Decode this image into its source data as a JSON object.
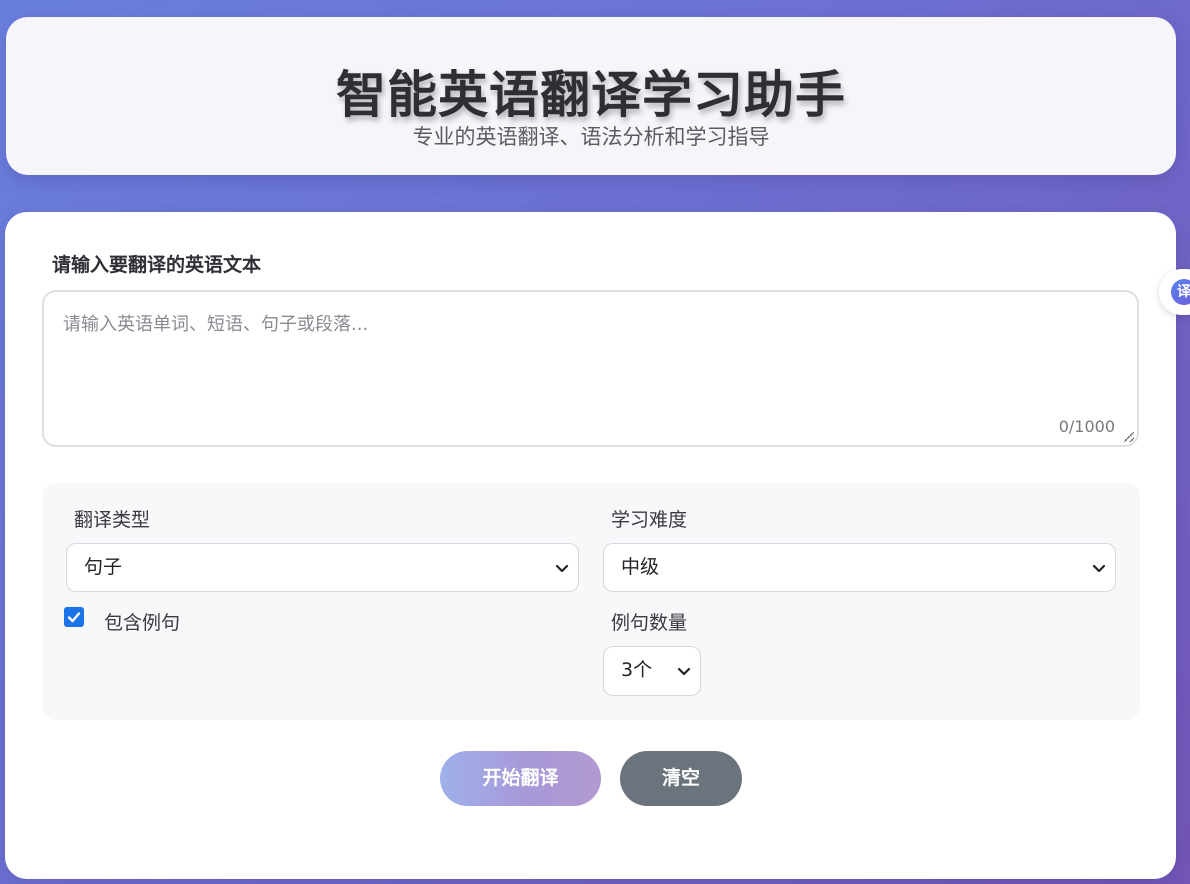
{
  "header": {
    "title": "智能英语翻译学习助手",
    "subtitle": "专业的英语翻译、语法分析和学习指导"
  },
  "input": {
    "label": "请输入要翻译的英语文本",
    "placeholder": "请输入英语单词、短语、句子或段落...",
    "value": "",
    "char_count": "0/1000"
  },
  "options": {
    "translation_type": {
      "label": "翻译类型",
      "selected": "句子"
    },
    "difficulty": {
      "label": "学习难度",
      "selected": "中级"
    },
    "include_examples": {
      "label": "包含例句",
      "checked": true
    },
    "example_count": {
      "label": "例句数量",
      "selected": "3个"
    }
  },
  "actions": {
    "translate_label": "开始翻译",
    "clear_label": "清空"
  },
  "floating_tab": {
    "glyph": "译"
  },
  "colors": {
    "background_start": "#6a7fdc",
    "background_end": "#7356b6",
    "checkbox_accent": "#1a73e8",
    "clear_button": "#6b737c"
  }
}
